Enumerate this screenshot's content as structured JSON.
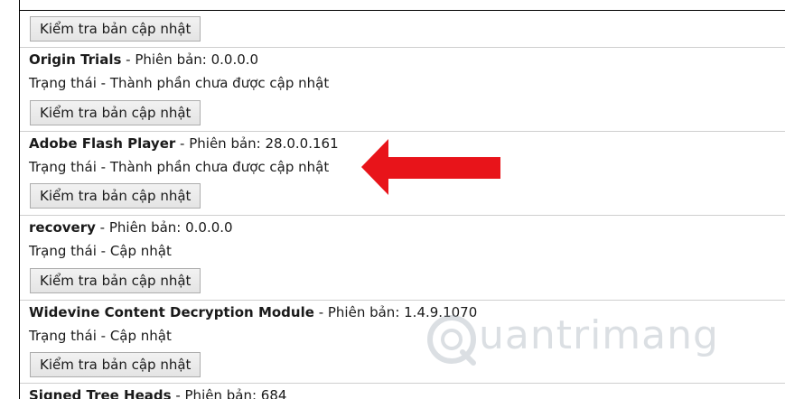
{
  "button_label": "Kiểm tra bản cập nhật",
  "version_prefix": " - Phiên bản: ",
  "status_prefix": "Trạng thái - ",
  "components": [
    {
      "name": "Origin Trials",
      "version": "0.0.0.0",
      "status": "Thành phần chưa được cập nhật"
    },
    {
      "name": "Adobe Flash Player",
      "version": "28.0.0.161",
      "status": "Thành phần chưa được cập nhật"
    },
    {
      "name": "recovery",
      "version": "0.0.0.0",
      "status": "Cập nhật"
    },
    {
      "name": "Widevine Content Decryption Module",
      "version": "1.4.9.1070",
      "status": "Cập nhật"
    },
    {
      "name": "Signed Tree Heads",
      "version": "684"
    }
  ],
  "watermark": "uantrimang",
  "colors": {
    "arrow": "#e8141a",
    "watermark": "#9aa6b2"
  },
  "icons": [
    "red-arrow-icon",
    "watermark-logo-icon"
  ]
}
